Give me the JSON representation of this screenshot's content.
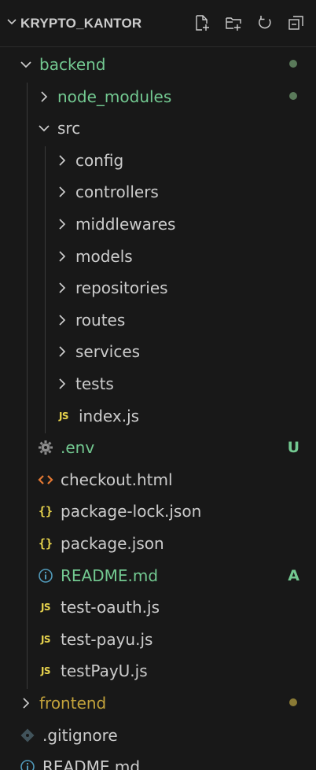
{
  "explorer": {
    "title": "KRYPTO_KANTOR",
    "actions": [
      {
        "name": "new-file-icon"
      },
      {
        "name": "new-folder-icon"
      },
      {
        "name": "refresh-icon"
      },
      {
        "name": "collapse-all-icon"
      }
    ]
  },
  "colors": {
    "background": "#181818",
    "default_text": "#cccccc",
    "untracked_green": "#73c991",
    "ignored_folder": "#8c8c8c",
    "modified_yellow": "#c2a23b",
    "folder_yellow": "#e2c08d",
    "html_orange": "#e37933",
    "readme_blue": "#519aba"
  },
  "tree": [
    {
      "label": "backend",
      "kind": "folder-open",
      "status": "dot",
      "status_color": "#5a7a5a",
      "color": "#73c991"
    },
    {
      "label": "node_modules",
      "kind": "folder-closed",
      "status": "dot",
      "status_color": "#5a7a5a",
      "color": "#73c991"
    },
    {
      "label": "src",
      "kind": "folder-open",
      "color": "#cccccc"
    },
    {
      "label": "config",
      "kind": "folder-closed",
      "color": "#cccccc"
    },
    {
      "label": "controllers",
      "kind": "folder-closed",
      "color": "#cccccc"
    },
    {
      "label": "middlewares",
      "kind": "folder-closed",
      "color": "#cccccc"
    },
    {
      "label": "models",
      "kind": "folder-closed",
      "color": "#cccccc"
    },
    {
      "label": "repositories",
      "kind": "folder-closed",
      "color": "#cccccc"
    },
    {
      "label": "routes",
      "kind": "folder-closed",
      "color": "#cccccc"
    },
    {
      "label": "services",
      "kind": "folder-closed",
      "color": "#cccccc"
    },
    {
      "label": "tests",
      "kind": "folder-closed",
      "color": "#cccccc"
    },
    {
      "label": "index.js",
      "kind": "js",
      "color": "#cccccc"
    },
    {
      "label": ".env",
      "kind": "gear",
      "status": "U",
      "status_color": "#73c991",
      "color": "#73c991"
    },
    {
      "label": "checkout.html",
      "kind": "html",
      "color": "#cccccc"
    },
    {
      "label": "package-lock.json",
      "kind": "json",
      "color": "#cccccc"
    },
    {
      "label": "package.json",
      "kind": "json",
      "color": "#cccccc"
    },
    {
      "label": "README.md",
      "kind": "info",
      "status": "A",
      "status_color": "#73c991",
      "color": "#73c991"
    },
    {
      "label": "test-oauth.js",
      "kind": "js",
      "color": "#cccccc"
    },
    {
      "label": "test-payu.js",
      "kind": "js",
      "color": "#cccccc"
    },
    {
      "label": "testPayU.js",
      "kind": "js",
      "color": "#cccccc"
    },
    {
      "label": "frontend",
      "kind": "folder-closed",
      "status": "dot",
      "status_color": "#8a7a35",
      "color": "#c2a23b"
    },
    {
      "label": ".gitignore",
      "kind": "git",
      "color": "#cccccc"
    },
    {
      "label": "README.md",
      "kind": "info",
      "color": "#cccccc"
    }
  ]
}
